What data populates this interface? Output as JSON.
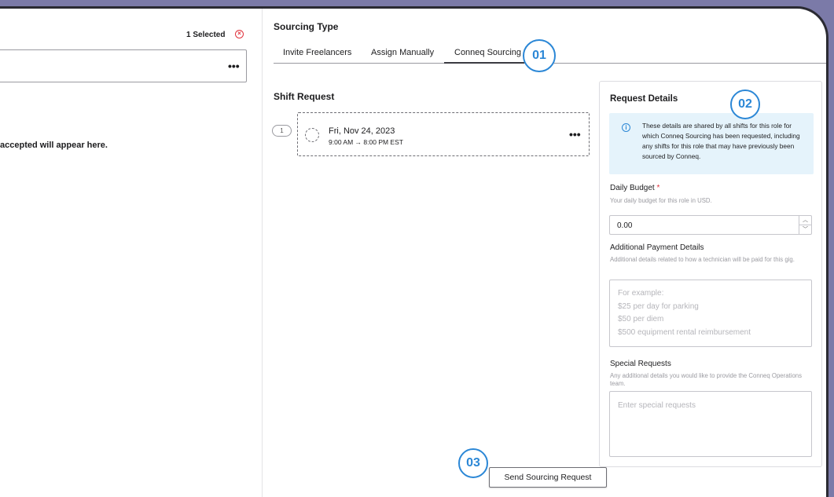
{
  "left": {
    "selected_count": "1 Selected",
    "clear_icon": "x-circle-icon",
    "selection_more": "•••",
    "empty_message": "accepted will appear here."
  },
  "sourcing": {
    "title": "Sourcing Type",
    "tabs": [
      {
        "label": "Invite Freelancers",
        "active": false
      },
      {
        "label": "Assign Manually",
        "active": false
      },
      {
        "label": "Conneq Sourcing",
        "active": true
      }
    ]
  },
  "callouts": {
    "c1": "01",
    "c2": "02",
    "c3": "03"
  },
  "callout_color": "#2b87d6",
  "shift": {
    "title": "Shift Request",
    "index": "1",
    "date": "Fri, Nov 24, 2023",
    "time": "9:00 AM → 8:00 PM EST",
    "more": "•••"
  },
  "details": {
    "title": "Request Details",
    "info_icon": "info-icon",
    "info_text": "These details are shared by all shifts for this role for which Conneq Sourcing has been requested, including any shifts for this role that may have previously been sourced by Conneq.",
    "daily_budget": {
      "label": "Daily Budget",
      "required_mark": "*",
      "help": "Your daily budget for this role in USD.",
      "value": "0.00"
    },
    "payment": {
      "label": "Additional Payment Details",
      "help": "Additional details related to how a technician will be paid for this gig.",
      "placeholder_lines": [
        "For example:",
        "$25 per day for parking",
        "$50 per diem",
        "$500 equipment rental reimbursement"
      ]
    },
    "special": {
      "label": "Special Requests",
      "help": "Any additional details you would like to provide the Conneq Operations team.",
      "placeholder": "Enter special requests"
    }
  },
  "send_button": "Send Sourcing Request"
}
